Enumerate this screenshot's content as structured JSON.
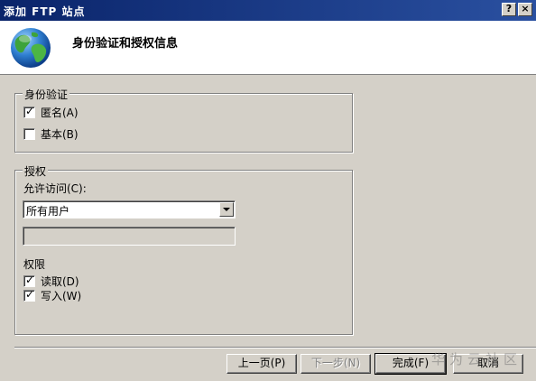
{
  "window": {
    "title": "添加 FTP 站点",
    "help_label": "?",
    "close_label": "×"
  },
  "header": {
    "title": "身份验证和授权信息"
  },
  "authentication": {
    "legend": "身份验证",
    "anonymous": {
      "label": "匿名(A)",
      "checked": true
    },
    "basic": {
      "label": "基本(B)",
      "checked": false
    }
  },
  "authorization": {
    "legend": "授权",
    "allow_access_label": "允许访问(C):",
    "allow_access_value": "所有用户",
    "user_field_value": "",
    "permissions_label": "权限",
    "read": {
      "label": "读取(D)",
      "checked": true
    },
    "write": {
      "label": "写入(W)",
      "checked": true
    }
  },
  "buttons": {
    "prev": "上一页(P)",
    "next": "下一步(N)",
    "finish": "完成(F)",
    "cancel": "取消"
  },
  "watermark": "华为云社区",
  "colors": {
    "titlebar": "#0a246a",
    "dialog_bg": "#d4d0c8",
    "header_bg": "#ffffff"
  }
}
